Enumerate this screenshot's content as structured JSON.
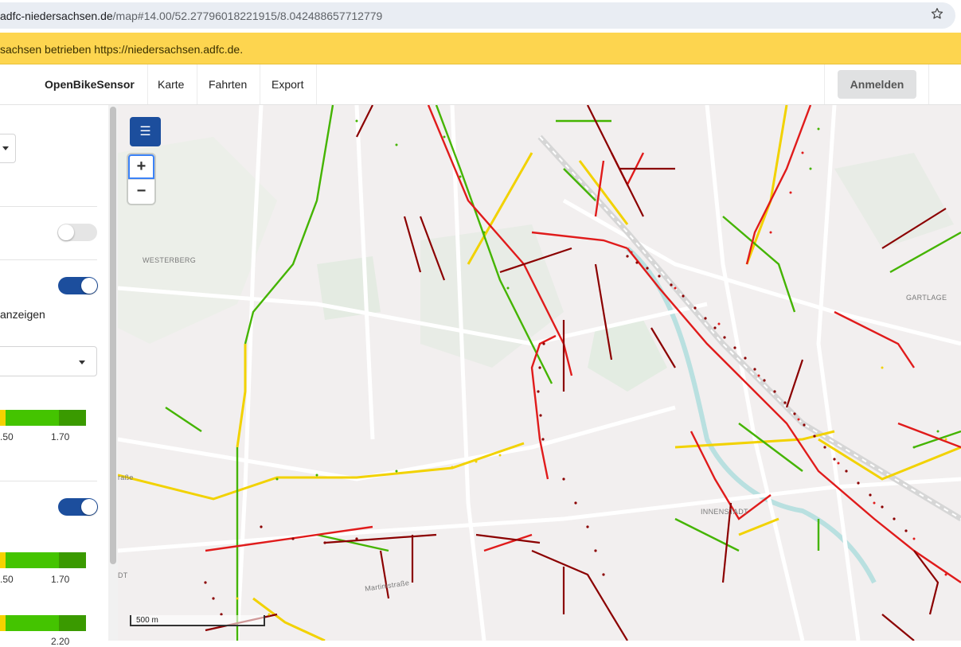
{
  "browser": {
    "url_host": "adfc-niedersachsen.de",
    "url_path": "/map#14.00/52.27796018221915/8.042488657712779",
    "bookmark_icon": "star-icon"
  },
  "banner": {
    "text": "sachsen betrieben https://niedersachsen.adfc.de."
  },
  "navbar": {
    "brand": "OpenBikeSensor",
    "items": [
      "Karte",
      "Fahrten",
      "Export"
    ],
    "login_label": "Anmelden"
  },
  "sidebar": {
    "toggle1_on": false,
    "toggle2_on": true,
    "toggle2_label": "anzeigen",
    "scale1_ticks": [
      ".50",
      "1.70"
    ],
    "toggle3_on": true,
    "scale2_ticks": [
      ".50",
      "1.70"
    ],
    "scale3_ticks": [
      "",
      "2.20"
    ],
    "scale_colors": [
      "#f5d200",
      "#44c400",
      "#44c400",
      "#3a9a00"
    ]
  },
  "map": {
    "menu_icon": "hamburger-icon",
    "zoom_in": "+",
    "zoom_out": "−",
    "scale_label": "500 m",
    "labels": {
      "westerberg": "WESTERBERG",
      "gartlage": "GARTLAGE",
      "innenstadt": "INNENSTADT",
      "martinistrasse": "Martinistraße",
      "strasse_left": "raße",
      "dt": "DT"
    },
    "colors": {
      "red": "#e01b1b",
      "darkred": "#8b0000",
      "green": "#44b400",
      "yellow": "#f2d200",
      "water": "#a9dede",
      "park": "#e3ece2"
    }
  }
}
